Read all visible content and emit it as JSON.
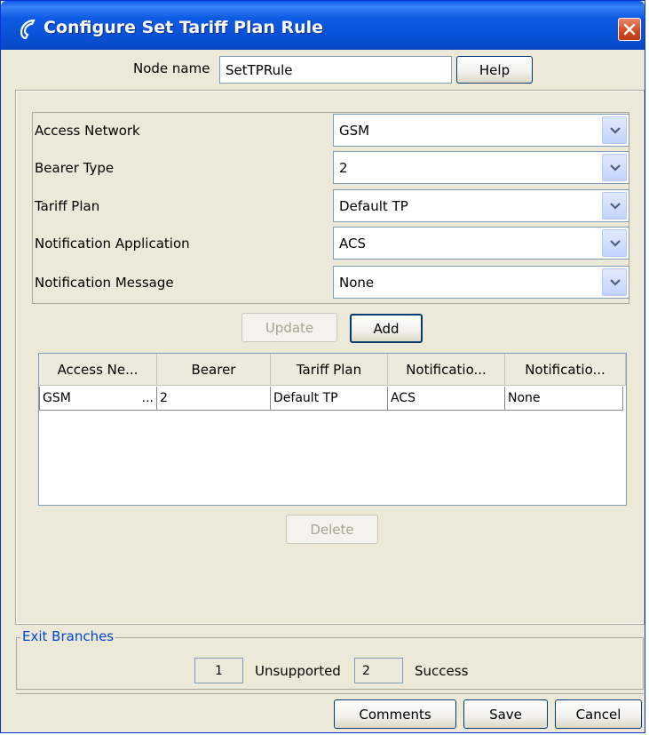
{
  "window": {
    "title": "Configure Set Tariff Plan Rule",
    "title_icon": "phone-handset-icon",
    "close_icon": "close-icon"
  },
  "header": {
    "node_name_label": "Node name",
    "node_name_value": "SetTPRule",
    "help_label": "Help"
  },
  "fields": [
    {
      "label": "Access Network",
      "value": "GSM"
    },
    {
      "label": "Bearer Type",
      "value": "2"
    },
    {
      "label": "Tariff Plan",
      "value": "Default TP"
    },
    {
      "label": "Notification Application",
      "value": "ACS"
    },
    {
      "label": "Notification Message",
      "value": "None"
    }
  ],
  "actions": {
    "update_label": "Update",
    "add_label": "Add",
    "delete_label": "Delete"
  },
  "table": {
    "columns": [
      "Access Ne...",
      "Bearer",
      "Tariff Plan",
      "Notificatio...",
      "Notificatio..."
    ],
    "rows": [
      [
        "GSM",
        "...",
        "2",
        "Default TP",
        "ACS",
        "None"
      ]
    ]
  },
  "exit_branches": {
    "legend": "Exit Branches",
    "items": [
      {
        "number": "1",
        "label": "Unsupported"
      },
      {
        "number": "2",
        "label": "Success"
      }
    ]
  },
  "footer": {
    "comments_label": "Comments",
    "save_label": "Save",
    "cancel_label": "Cancel"
  },
  "colors": {
    "titlebar": "#0751d6",
    "window_bg": "#ece9d8",
    "legend_text": "#0046d5",
    "close_button": "#d5471f"
  }
}
